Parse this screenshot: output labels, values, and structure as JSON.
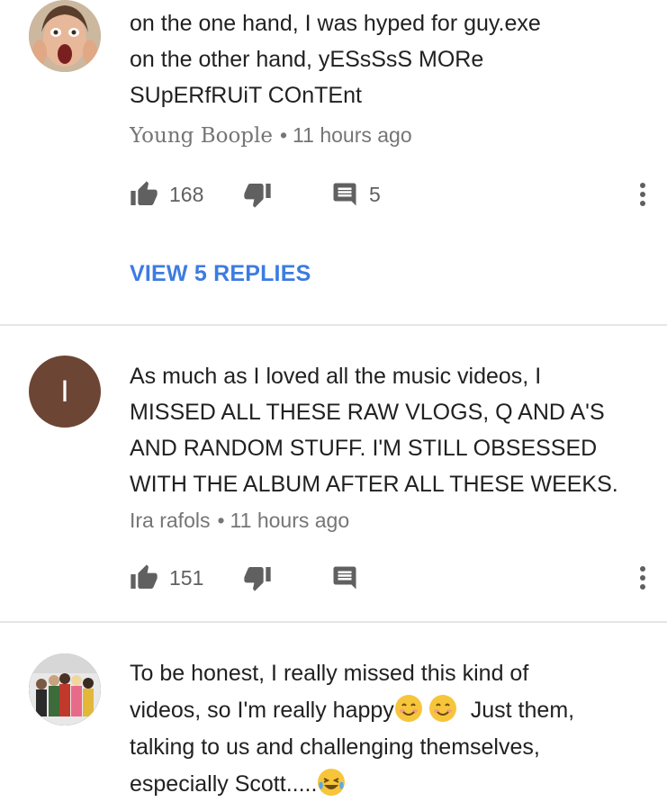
{
  "comments": [
    {
      "lines": [
        "on the one hand, I was hyped for guy.exe",
        "on the other hand, yESsSsS MORe",
        "SUpERfRUiT COnTEnt"
      ],
      "author": "Young Boople",
      "time": "11 hours ago",
      "likes": "168",
      "reply_count": "5",
      "view_replies": "VIEW 5 REPLIES"
    },
    {
      "avatar_letter": "I",
      "avatar_color": "#6d4535",
      "lines": [
        "As much as I loved all the music videos, I",
        "MISSED ALL THESE RAW VLOGS, Q AND A'S",
        "AND RANDOM STUFF. I'M STILL OBSESSED",
        "WITH THE ALBUM AFTER ALL THESE WEEKS."
      ],
      "author": "Ira rafols",
      "time": "11 hours ago",
      "likes": "151"
    },
    {
      "lines": [
        "To be honest, I really missed this kind of",
        "videos, so I'm really happy",
        "Just them,",
        "talking to us and challenging themselves,",
        "especially Scott....."
      ]
    }
  ],
  "meta_separator": "•",
  "icons": [
    "like-icon",
    "dislike-icon",
    "reply-icon",
    "more-options-icon",
    "smiling-face-emoji",
    "laughing-crying-emoji"
  ],
  "colors": {
    "link_blue": "#3d7ce0",
    "meta_gray": "#757575",
    "icon_gray": "#606060"
  }
}
